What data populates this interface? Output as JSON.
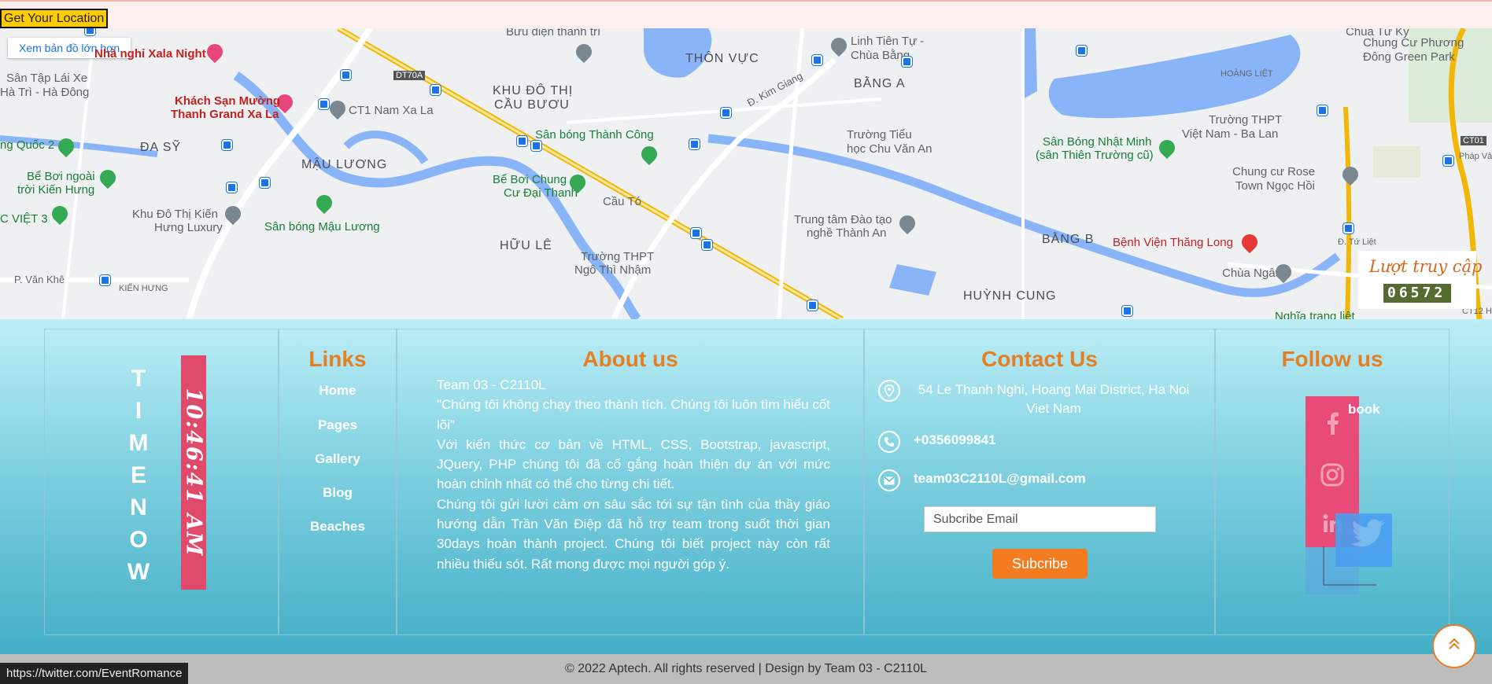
{
  "topbar": {
    "location_button": "Get Your Location"
  },
  "map": {
    "bigger_map_link": "Xem bản đồ lớn hơn",
    "labels": {
      "xala": "Nhà nghỉ Xala Night",
      "buudien": "Bưu điện thanh trì",
      "thonvuc": "THÔN VỰC",
      "linhtien": "Linh Tiên Tự -",
      "chuabang": "Chùa Bằng",
      "chuatuky": "Chùa Tứ Kỳ",
      "greenpark1": "Chung Cư Phương",
      "greenpark2": "Đông Green Park",
      "santap1": "Sân Tập Lái Xe",
      "santap2": "Hà Trì - Hà Đông",
      "muong1": "Khách Sạn Mường",
      "muong2": "Thanh Grand Xa La",
      "ct1": "CT1 Nam Xa La",
      "khudothi1": "KHU ĐÔ THỊ",
      "khudothi2": "CẦU BƯƠU",
      "banga": "BẰNG A",
      "hoangliet": "HOÀNG LIỆT",
      "thcs1": "Trường THPT",
      "thcs2": "Việt Nam - Ba Lan",
      "quoc2": "ng Quốc 2",
      "dasy": "ĐA SỸ",
      "mauluong": "MẬU LƯƠNG",
      "thanhcong": "Sân bóng Thành Công",
      "tieuhoc1": "Trường Tiểu",
      "tieuhoc2": "học Chu Văn An",
      "nhatminh1": "Sân Bóng Nhật Minh",
      "nhatminh2": "(sân Thiên Trường cũ)",
      "beboi1": "Bể Bơi ngoài",
      "beboi2": "trời Kiến Hưng",
      "beboichung1": "Bể Bơi Chung",
      "beboichung2": "Cư Đại Thanh",
      "cauto": "Cầu Tó",
      "chungcurose1": "Chung cư Rose",
      "chungcurose2": "Town Ngọc Hồi",
      "cviet3": "C VIỆT 3",
      "kienhung1": "Khu Đô Thị Kiến",
      "kienhung2": "Hưng Luxury",
      "sanbongmauluong": "Sân bóng Mậu Lương",
      "daotao1": "Trung tâm Đào tạo",
      "daotao2": "nghề Thành An",
      "bangb": "BẰNG B",
      "thanglong": "Bệnh Viện Thăng Long",
      "huule": "HỮU LÊ",
      "thptngo1": "Trường THPT",
      "thptngo2": "Ngô Thì Nhậm",
      "chuangau": "Chùa Ngâu",
      "pvankhe": "P. Văn Khê",
      "kienhung": "KIẾN HƯNG",
      "huynhcung": "HUỲNH CUNG",
      "nghiatrang": "Nghĩa trang liệt",
      "dt70a": "DT70A",
      "kimgiang": "Đ. Kim Giang",
      "ct01": "CT01",
      "phapvan": "Pháp Vân",
      "ct12": "CT12 H",
      "tuliet": "Đ. Tứ Liệt"
    },
    "counter": {
      "title": "Lượt truy cập",
      "digits": "06572"
    }
  },
  "time_column": {
    "label_letters": [
      "T",
      "I",
      "M",
      "E",
      "N",
      "O",
      "W"
    ],
    "clock": "10:46:41 AM"
  },
  "links": {
    "title": "Links",
    "items": [
      "Home",
      "Pages",
      "Gallery",
      "Blog",
      "Beaches"
    ]
  },
  "about": {
    "title": "About us",
    "team": "Team 03 - C2110L",
    "quote": "\"Chúng tôi không chạy theo thành tích. Chúng tôi luôn tìm hiểu cốt lõi\"",
    "para1": "Với kiến thức cơ bản về HTML, CSS, Bootstrap, javascript, JQuery, PHP chúng tôi đã cố gắng hoàn thiện dự án với mức hoàn chỉnh nhất có thể cho từng chi tiết.",
    "para2": "Chúng tôi gửi lười cảm ơn sâu sắc tới sự tận tình của thầy giáo hướng dẫn Trần Văn Điệp đã hỗ trợ team trong suốt thời gian 30days hoàn thành project. Chúng tôi biết project này còn rất nhiều thiếu sót. Rất mong được mọi người góp ý."
  },
  "contact": {
    "title": "Contact Us",
    "address": "54 Le Thanh Nghi, Hoang Mai District, Ha Noi Viet Nam",
    "phone": "+0356099841",
    "email": "team03C2110L@gmail.com",
    "subscribe_placeholder": "Subcribe Email",
    "subscribe_button": "Subcribe"
  },
  "follow": {
    "title": "Follow us",
    "facebook_label": "book",
    "icons": [
      "facebook-icon",
      "instagram-icon",
      "linkedin-icon",
      "twitter-icon"
    ]
  },
  "bottom": {
    "copyright": "© 2022 Aptech. All rights reserved | Design by Team 03 - C2110L"
  },
  "status_url": "https://twitter.com/EventRomance",
  "colors": {
    "accent": "#e67e22",
    "clock_bg": "#e04a6a",
    "subscribe": "#f47c20"
  }
}
